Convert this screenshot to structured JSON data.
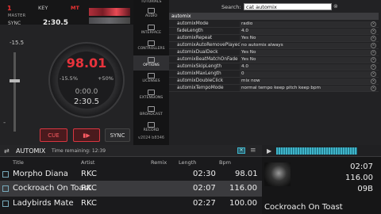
{
  "deck": {
    "number": "1",
    "master_label": "MASTER",
    "key_label": "KEY",
    "mt_label": "MT",
    "sync_label": "SYNC",
    "remaining": "2:30.5",
    "pitch_range": "-15.5",
    "bpm": "98.01",
    "pitch_minus": "-15.5%",
    "pitch_plus": "+50%",
    "elapsed": "0:00.0",
    "time": "2:30.5",
    "cue_label": "CUE",
    "play_label": "▮▶",
    "sync_button": "SYNC",
    "minus": "-"
  },
  "nav": {
    "items": [
      {
        "label": "TUTORIALS"
      },
      {
        "label": "AUDIO"
      },
      {
        "label": "INTERFACE"
      },
      {
        "label": "CONTROLLERS"
      },
      {
        "label": "OPTIONS"
      },
      {
        "label": "LICENSES"
      },
      {
        "label": "EXTENSIONS"
      },
      {
        "label": "BROADCAST"
      },
      {
        "label": "RECORD"
      }
    ],
    "version": "v2024 b8346"
  },
  "settings": {
    "search_label": "Search:",
    "search_value": "cat automix",
    "header": "automix",
    "rows": [
      {
        "key": "automixMode",
        "value": "radio"
      },
      {
        "key": "fadeLength",
        "value": "4.0"
      },
      {
        "key": "automixRepeat",
        "value": "Yes  No"
      },
      {
        "key": "automixAutoRemovePlayed",
        "value": "no   automix   always"
      },
      {
        "key": "automixDualDeck",
        "value": "Yes  No"
      },
      {
        "key": "automixBeatMatchOnFade",
        "value": "Yes  No"
      },
      {
        "key": "automixSkipLength",
        "value": "4.0"
      },
      {
        "key": "automixMaxLength",
        "value": "0"
      },
      {
        "key": "automixDoubleClick",
        "value": "mix now"
      },
      {
        "key": "automixTempoMode",
        "value": "normal tempo   keep pitch   keep bpm"
      }
    ]
  },
  "automix": {
    "title": "AUTOMIX",
    "time_remaining": "Time remaining: 12:39",
    "columns": {
      "title": "Title",
      "artist": "Artist",
      "remix": "Remix",
      "length": "Length",
      "bpm": "Bpm"
    },
    "tracks": [
      {
        "title": "Morpho Diana",
        "artist": "RKC",
        "remix": "",
        "length": "02:30",
        "bpm": "98.01"
      },
      {
        "title": "Cockroach On Toast",
        "artist": "RKC",
        "remix": "",
        "length": "02:07",
        "bpm": "116.00"
      },
      {
        "title": "Ladybirds Mate",
        "artist": "RKC",
        "remix": "",
        "length": "02:27",
        "bpm": "100.00"
      }
    ]
  },
  "preview": {
    "length": "02:07",
    "bpm": "116.00",
    "key": "09B",
    "title": "Cockroach On Toast"
  }
}
